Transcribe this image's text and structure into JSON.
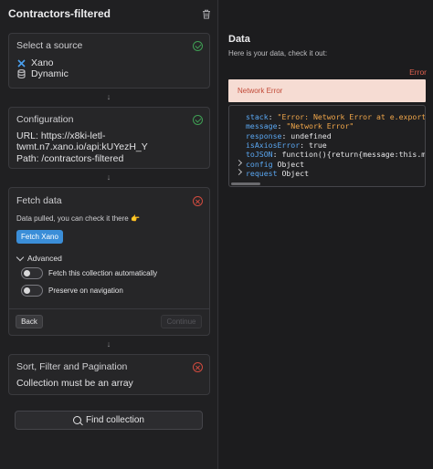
{
  "panel": {
    "title": "Contractors-filtered"
  },
  "source": {
    "title": "Select a source",
    "items": [
      {
        "label": "Xano",
        "icon": "xano-icon"
      },
      {
        "label": "Dynamic",
        "icon": "database-icon"
      }
    ]
  },
  "configuration": {
    "title": "Configuration",
    "url_line1": "URL: https://x8ki-letl-",
    "url_line2": "twmt.n7.xano.io/api:kUYezH_Y",
    "path": "Path: /contractors-filtered"
  },
  "fetch": {
    "title": "Fetch data",
    "message": "Data pulled, you can check it there 👉",
    "button": "Fetch Xano",
    "advanced": "Advanced",
    "toggle1": "Fetch this collection automatically",
    "toggle2": "Preserve on navigation",
    "back": "Back",
    "continue": "Continue"
  },
  "sort": {
    "title": "Sort, Filter and Pagination",
    "message": "Collection must be an array"
  },
  "find_button": "Find collection",
  "data_panel": {
    "title": "Data",
    "subtitle": "Here is your data, check it out:",
    "error_label": "Error",
    "banner": "Network Error",
    "lines": [
      {
        "key": "stack",
        "sep": ": ",
        "value": "\"Error: Network Error at e.exports (http"
      },
      {
        "key": "message",
        "sep": ": ",
        "value": "\"Network Error\""
      },
      {
        "key": "response",
        "sep": ": ",
        "value": "undefined"
      },
      {
        "key": "isAxiosError",
        "sep": ": ",
        "value": "true"
      },
      {
        "key": "toJSON",
        "sep": ": ",
        "value": "function(){return{message:this.mess"
      },
      {
        "key": "config",
        "sep": "  ",
        "value": "Object"
      },
      {
        "key": "request",
        "sep": "  ",
        "value": "Object"
      }
    ]
  },
  "colors": {
    "success": "#3f9f54",
    "error": "#d24b3f",
    "accent": "#3b8ed8"
  }
}
